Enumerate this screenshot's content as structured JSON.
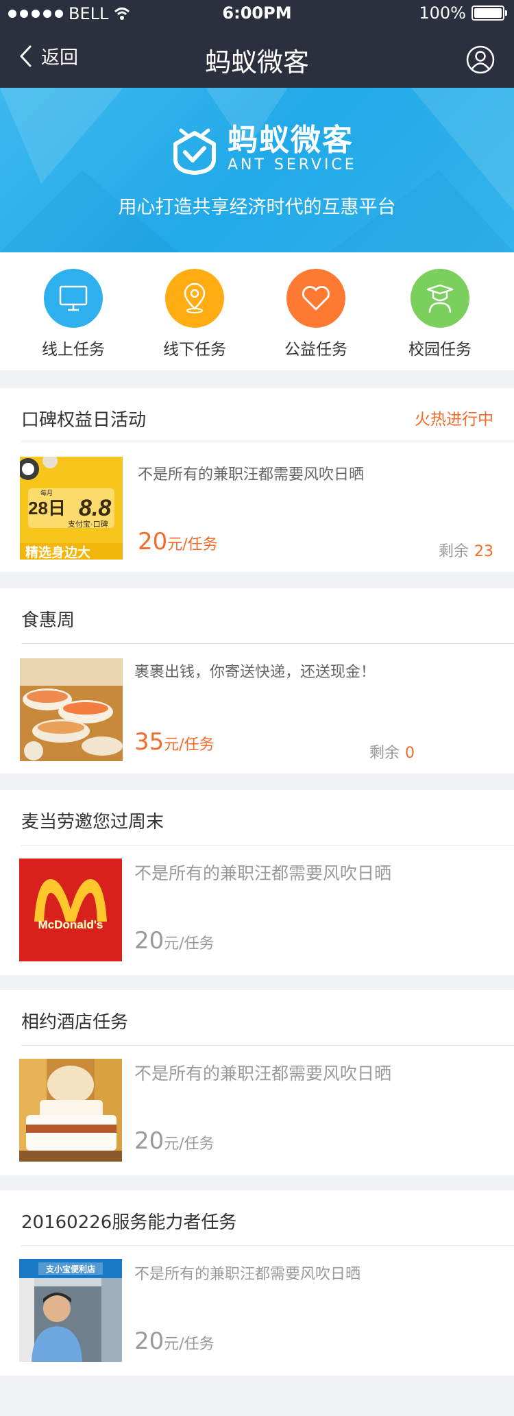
{
  "status_bar": {
    "carrier": "BELL",
    "time": "6:00PM",
    "battery": "100%"
  },
  "nav": {
    "back_label": "返回",
    "title": "蚂蚁微客"
  },
  "banner": {
    "logo_cn": "蚂蚁微客",
    "logo_en": "ANT SERVICE",
    "slogan": "用心打造共享经济时代的互惠平台"
  },
  "categories": [
    {
      "label": "线上任务",
      "color": "#2fb0ee",
      "icon": "monitor-icon"
    },
    {
      "label": "线下任务",
      "color": "#ffad12",
      "icon": "location-pin-icon"
    },
    {
      "label": "公益任务",
      "color": "#fe7a33",
      "icon": "heart-icon"
    },
    {
      "label": "校园任务",
      "color": "#7bcf5c",
      "icon": "graduate-icon"
    }
  ],
  "tasks": [
    {
      "title": "口碑权益日活动",
      "status": "火热进行中",
      "desc": "不是所有的兼职汪都需要风吹日晒",
      "price": "20",
      "unit": "元/任务",
      "remain_label": "剩余",
      "remain": "23",
      "thumb": "koubei-promo"
    },
    {
      "title": "食惠周",
      "desc": "裹裹出钱，你寄送快递，还送现金！",
      "price": "35",
      "unit": "元/任务",
      "remain_label": "剩余",
      "remain": "0",
      "thumb": "sushi-photo"
    },
    {
      "title": "麦当劳邀您过周末",
      "desc": "不是所有的兼职汪都需要风吹日晒",
      "price": "20",
      "unit": "元/任务",
      "thumb": "mcdonalds-logo",
      "thumb_text": "McDonald's"
    },
    {
      "title": "相约酒店任务",
      "desc": "不是所有的兼职汪都需要风吹日晒",
      "price": "20",
      "unit": "元/任务",
      "thumb": "hotel-room-photo"
    },
    {
      "title": "20160226服务能力者任务",
      "desc": "不是所有的兼职汪都需要风吹日晒",
      "price": "20",
      "unit": "元/任务",
      "thumb": "store-person-photo",
      "thumb_text": "支小宝便利店"
    }
  ],
  "promo_text": {
    "month": "每月",
    "day": "28日",
    "big": "8.8",
    "brand": "支付宝·口碑",
    "bottom": "精选身边大"
  },
  "colors": {
    "accent": "#f26b2b",
    "nav_bg": "#2b2f3e",
    "banner": "#25abe9"
  }
}
